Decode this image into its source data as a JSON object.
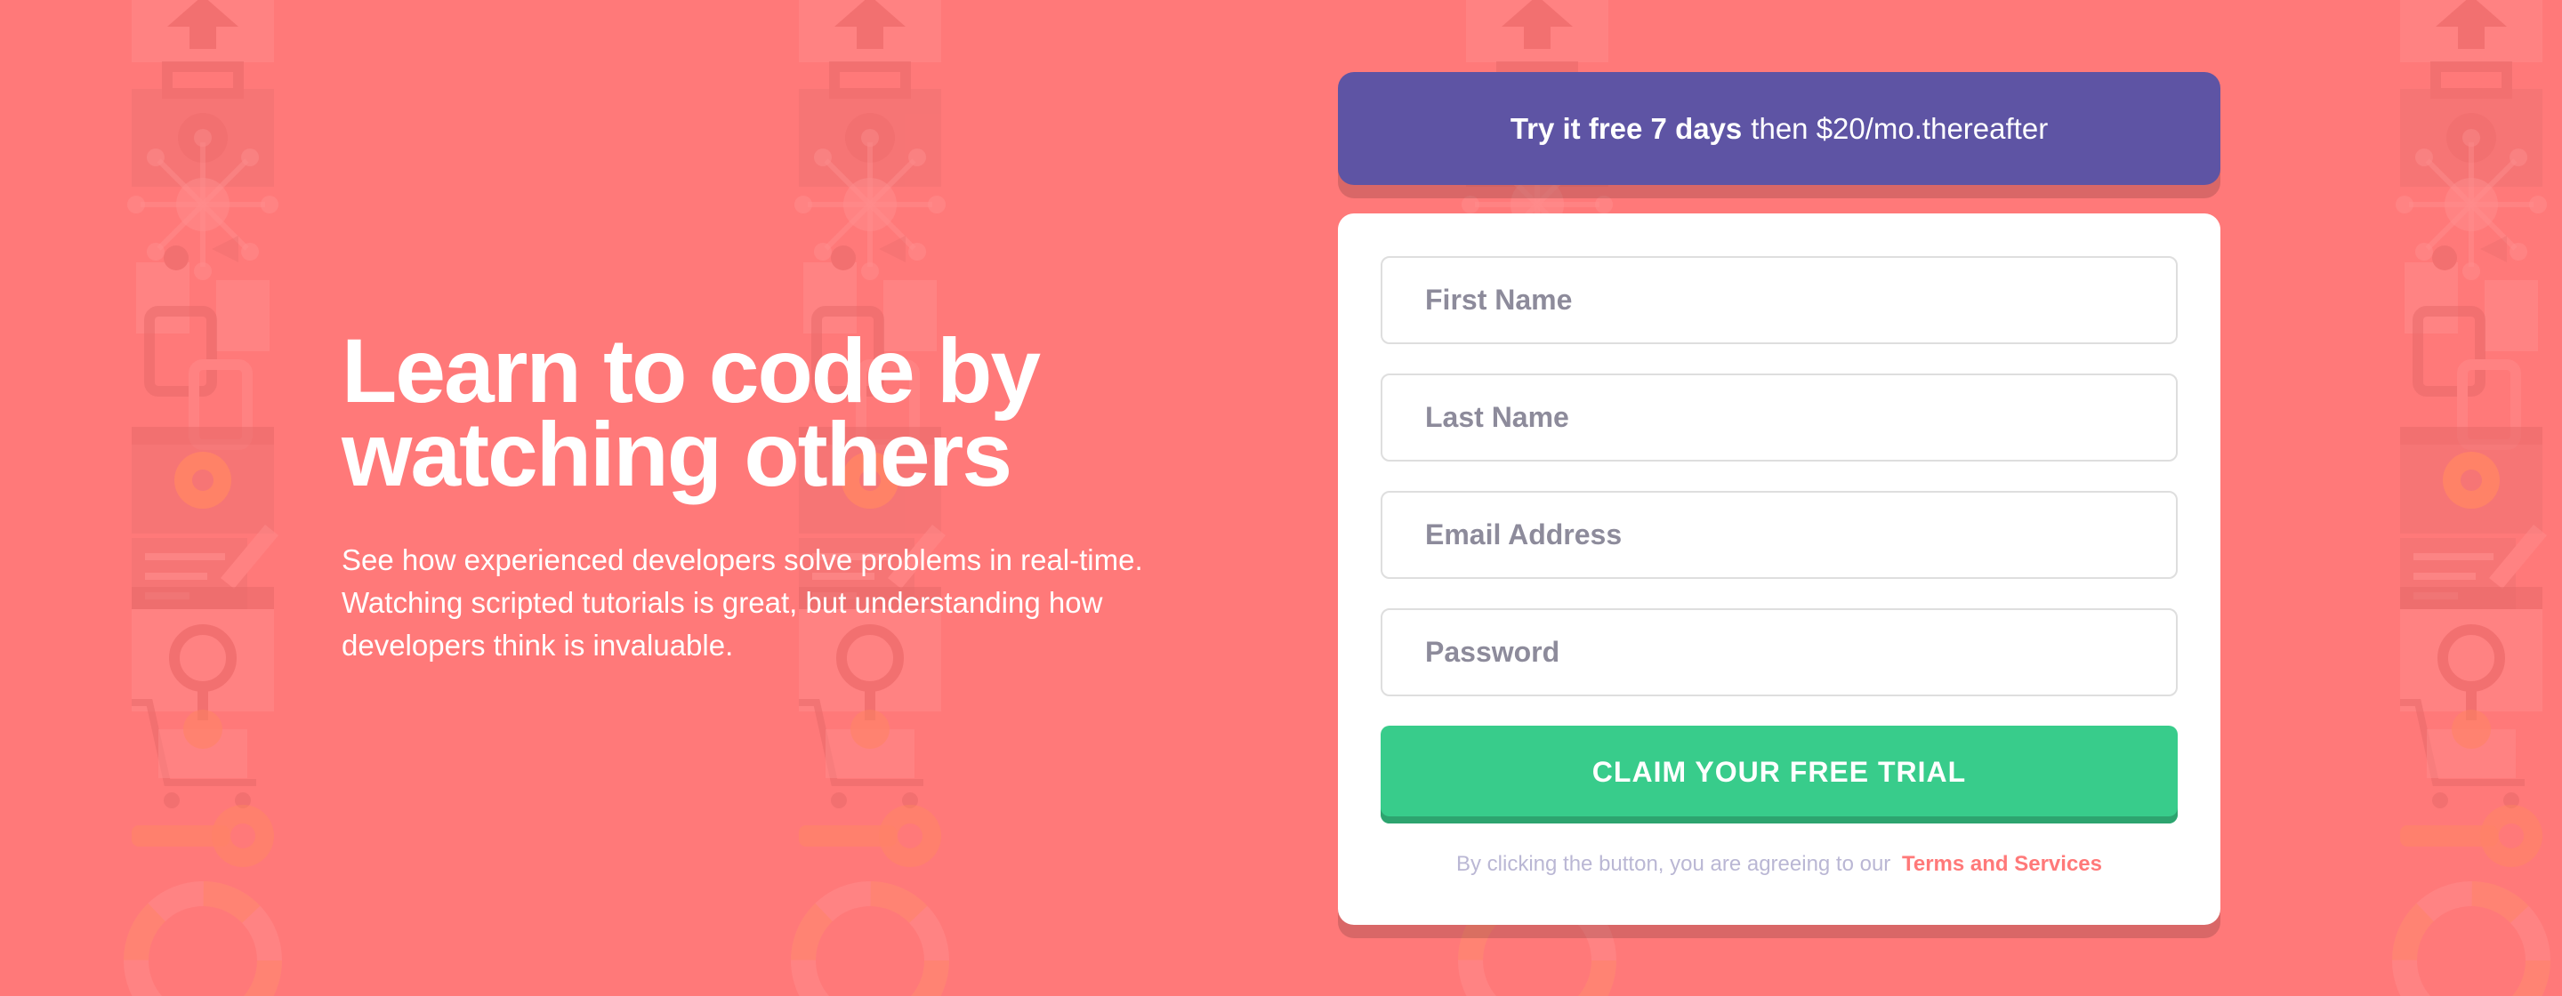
{
  "colors": {
    "background": "#ff7979",
    "promo_bg": "#5e54a4",
    "cta_bg": "#38cc8b",
    "cta_shadow": "#2da46f",
    "terms_link": "#ff7979",
    "card_bg": "#ffffff"
  },
  "hero": {
    "title_line1": "Learn to code by",
    "title_line2": "watching others",
    "description": "See how experienced developers solve problems in real-time. Watching scripted tutorials is great, but understanding how developers think is invaluable."
  },
  "promo": {
    "bold": "Try it free 7 days",
    "rest": "then $20/mo.thereafter"
  },
  "form": {
    "first_name_placeholder": "First Name",
    "last_name_placeholder": "Last Name",
    "email_placeholder": "Email Address",
    "password_placeholder": "Password",
    "submit_label": "CLAIM YOUR FREE TRIAL",
    "terms_text": "By clicking the button, you are agreeing to our",
    "terms_link": "Terms and Services"
  },
  "background_icons": [
    "house-icon",
    "toolbox-icon",
    "network-icon",
    "files-icon",
    "link-icon",
    "settings-icon",
    "edit-icon",
    "search-icon",
    "cart-icon",
    "key-icon",
    "lifebuoy-icon"
  ]
}
